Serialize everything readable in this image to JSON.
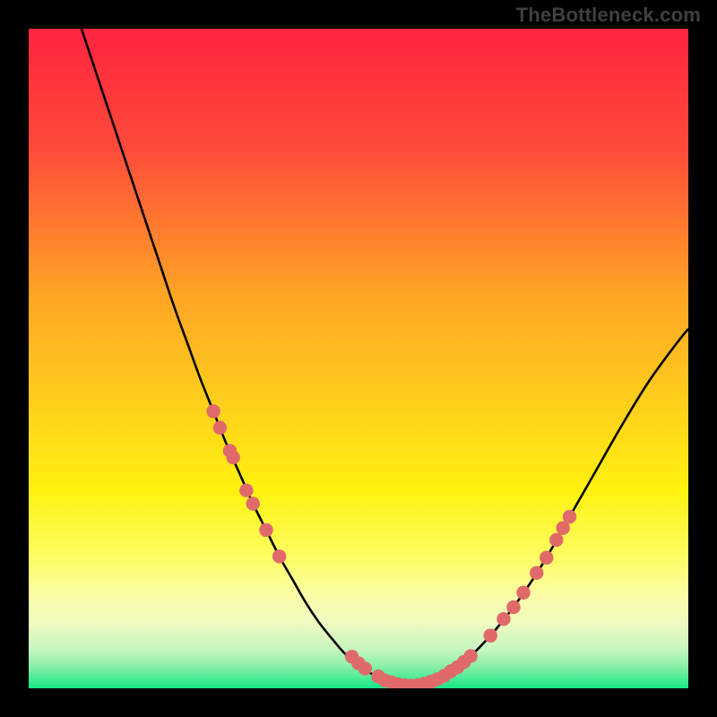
{
  "watermark": "TheBottleneck.com",
  "chart_data": {
    "type": "line",
    "title": "",
    "xlabel": "",
    "ylabel": "",
    "xlim": [
      0,
      100
    ],
    "ylim": [
      0,
      100
    ],
    "gradient_stops": [
      {
        "offset": 0.0,
        "color": "#ff2440"
      },
      {
        "offset": 0.18,
        "color": "#ff4a3a"
      },
      {
        "offset": 0.4,
        "color": "#ffa325"
      },
      {
        "offset": 0.58,
        "color": "#ffd21a"
      },
      {
        "offset": 0.7,
        "color": "#fff210"
      },
      {
        "offset": 0.8,
        "color": "#fdfd62"
      },
      {
        "offset": 0.86,
        "color": "#fcfda9"
      },
      {
        "offset": 0.9,
        "color": "#f0fac0"
      },
      {
        "offset": 0.94,
        "color": "#c9f6c0"
      },
      {
        "offset": 0.965,
        "color": "#8ef0a8"
      },
      {
        "offset": 1.0,
        "color": "#17e789"
      }
    ],
    "series": [
      {
        "name": "curve",
        "stroke": "#000000",
        "x": [
          8,
          10,
          12,
          14,
          16,
          18,
          20,
          22,
          24,
          26,
          28,
          30,
          32,
          34,
          36,
          38,
          40,
          42,
          44,
          46,
          48,
          50,
          52,
          54,
          56,
          58,
          60,
          62,
          66,
          70,
          74,
          78,
          82,
          86,
          90,
          94,
          98,
          100
        ],
        "y": [
          100,
          94,
          88,
          82,
          76,
          70,
          64,
          58,
          52.5,
          47,
          42,
          37,
          32.5,
          28,
          24,
          20,
          16.5,
          13,
          10,
          7.5,
          5.2,
          3.5,
          2.2,
          1.2,
          0.6,
          0.4,
          0.6,
          1.3,
          4,
          8,
          13,
          19,
          26,
          33,
          40,
          46.5,
          52,
          54.5
        ]
      }
    ],
    "markers": {
      "color": "#e06a6a",
      "r": 1.05,
      "points": [
        {
          "x": 28,
          "y": 42
        },
        {
          "x": 29,
          "y": 39.5
        },
        {
          "x": 30.5,
          "y": 36
        },
        {
          "x": 31,
          "y": 35
        },
        {
          "x": 33,
          "y": 30
        },
        {
          "x": 34,
          "y": 28
        },
        {
          "x": 36,
          "y": 24
        },
        {
          "x": 38,
          "y": 20
        },
        {
          "x": 49,
          "y": 4.8
        },
        {
          "x": 50,
          "y": 3.8
        },
        {
          "x": 51,
          "y": 3.0
        },
        {
          "x": 53,
          "y": 1.8
        },
        {
          "x": 54,
          "y": 1.2
        },
        {
          "x": 55,
          "y": 0.9
        },
        {
          "x": 56,
          "y": 0.6
        },
        {
          "x": 57,
          "y": 0.5
        },
        {
          "x": 58,
          "y": 0.4
        },
        {
          "x": 59,
          "y": 0.5
        },
        {
          "x": 60,
          "y": 0.7
        },
        {
          "x": 61,
          "y": 1.0
        },
        {
          "x": 62,
          "y": 1.4
        },
        {
          "x": 63,
          "y": 1.9
        },
        {
          "x": 64,
          "y": 2.6
        },
        {
          "x": 65,
          "y": 3.2
        },
        {
          "x": 66,
          "y": 4.0
        },
        {
          "x": 67,
          "y": 4.9
        },
        {
          "x": 70,
          "y": 8
        },
        {
          "x": 72,
          "y": 10.5
        },
        {
          "x": 73.5,
          "y": 12.3
        },
        {
          "x": 75,
          "y": 14.5
        },
        {
          "x": 77,
          "y": 17.5
        },
        {
          "x": 78.5,
          "y": 19.8
        },
        {
          "x": 80,
          "y": 22.5
        },
        {
          "x": 81,
          "y": 24.3
        },
        {
          "x": 82,
          "y": 26
        }
      ]
    }
  }
}
